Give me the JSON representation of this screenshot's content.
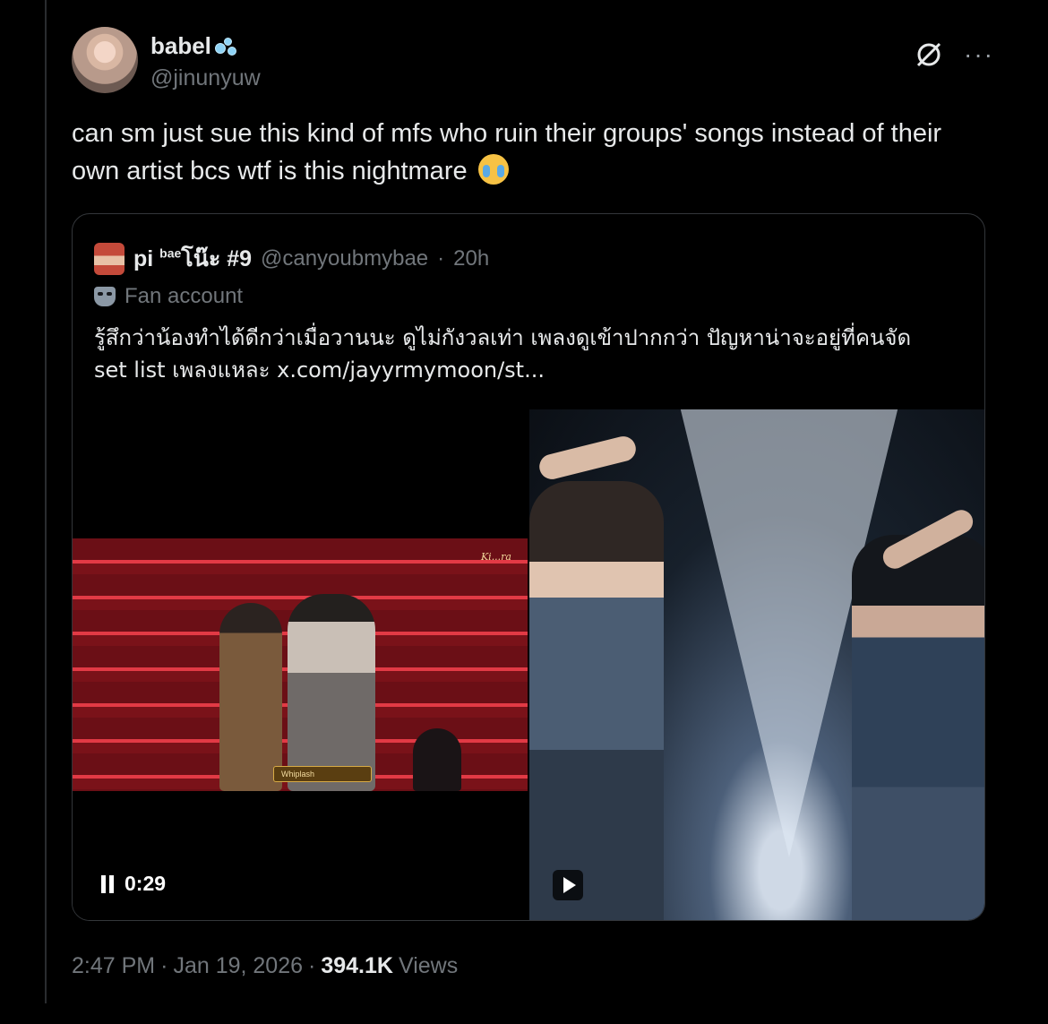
{
  "tweet": {
    "display_name": "babel",
    "name_emoji_icon": "bubbles-icon",
    "handle": "@jinunyuw",
    "text": "can sm just sue this kind of mfs who ruin their groups' songs instead of their own artist bcs wtf is this nightmare",
    "trailing_emoji_icon": "crying-face-icon",
    "time": "2:47 PM",
    "date": "Jan 19, 2026",
    "separator": "·",
    "views_count": "394.1K",
    "views_label": "Views"
  },
  "quote": {
    "display_name": "pi",
    "name_sup": "bae",
    "name_suffix": "โน๊ะ #9",
    "handle": "@canyoubmybae",
    "separator": "·",
    "age": "20h",
    "label": "Fan account",
    "text_line1": "รู้สึกว่าน้องทำได้ดีกว่าเมื่อวานนะ ดูไม่กังวลเท่า เพลงดูเข้าปากกว่า ปัญหาน่าจะอยู่ที่คนจัด",
    "text_line2": "set list เพลงแหละ  x.com/jayyrmymoon/st...",
    "video_left": {
      "time": "0:29",
      "stage_logo": "Ki...ra",
      "caption": "Whiplash"
    }
  },
  "colors": {
    "background": "#000000",
    "text": "#e7e9ea",
    "muted": "#71767b",
    "border": "#33363a"
  }
}
